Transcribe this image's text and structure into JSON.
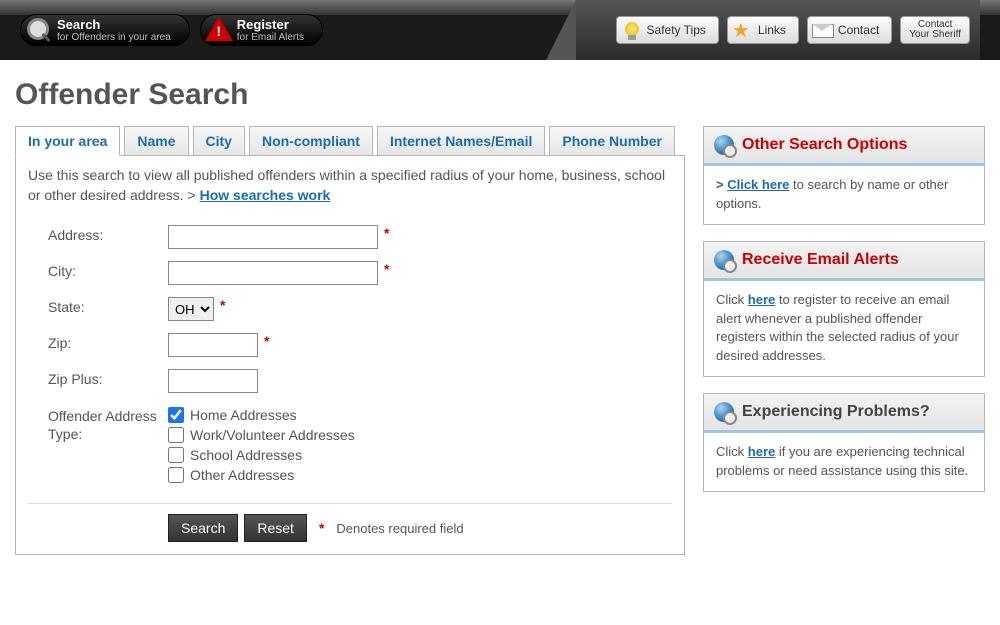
{
  "topnav": {
    "search": {
      "line1": "Search",
      "line2": "for Offenders in your area"
    },
    "register": {
      "line1": "Register",
      "line2": "for Email Alerts"
    },
    "safety": "Safety Tips",
    "links": "Links",
    "contact": "Contact",
    "sheriff": "Contact\nYour Sheriff"
  },
  "page_title": "Offender Search",
  "tabs": [
    "In your area",
    "Name",
    "City",
    "Non-compliant",
    "Internet Names/Email",
    "Phone Number"
  ],
  "intro": {
    "text": "Use this search to view all published offenders within a specified radius of your home, business, school or other desired address. > ",
    "link": "How searches work"
  },
  "form": {
    "address": {
      "label": "Address:",
      "value": ""
    },
    "city": {
      "label": "City:",
      "value": ""
    },
    "state": {
      "label": "State:",
      "value": "OH"
    },
    "zip": {
      "label": "Zip:",
      "value": ""
    },
    "zipplus": {
      "label": "Zip Plus:",
      "value": ""
    },
    "addrtype": {
      "label": "Offender Address Type:",
      "options": [
        {
          "label": "Home Addresses",
          "checked": true
        },
        {
          "label": "Work/Volunteer Addresses",
          "checked": false
        },
        {
          "label": "School Addresses",
          "checked": false
        },
        {
          "label": "Other Addresses",
          "checked": false
        }
      ]
    },
    "search_btn": "Search",
    "reset_btn": "Reset",
    "required_note": "Denotes required field"
  },
  "sidebar": {
    "other": {
      "title": "Other Search Options",
      "prefix": "> ",
      "link": "Click here",
      "suffix": " to search by name or other options."
    },
    "email": {
      "title": "Receive Email Alerts",
      "prefix": "Click ",
      "link": "here",
      "suffix": " to register to receive an email alert whenever a published offender registers within the selected radius of your desired addresses."
    },
    "problems": {
      "title": "Experiencing Problems?",
      "prefix": "Click ",
      "link": "here",
      "suffix": " if you are experiencing technical problems or need assistance using this site."
    }
  }
}
